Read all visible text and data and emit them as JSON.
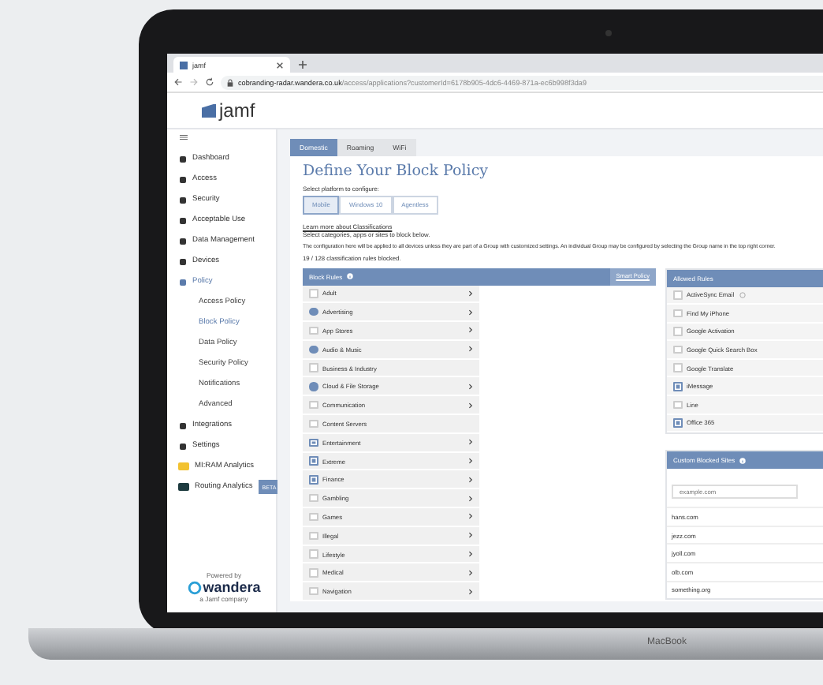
{
  "browser": {
    "tab_title": "jamf",
    "url_host": "cobranding-radar.wandera.co.uk",
    "url_path": "/access/applications?customerId=6178b905-4dc6-4469-871a-ec6b998f3da9"
  },
  "brand": "jamf",
  "sidebar": {
    "items": [
      {
        "label": "Dashboard",
        "kind": "nav",
        "selected": false
      },
      {
        "label": "Access",
        "kind": "nav",
        "selected": false
      },
      {
        "label": "Security",
        "kind": "nav",
        "selected": false
      },
      {
        "label": "Acceptable Use",
        "kind": "nav",
        "selected": false
      },
      {
        "label": "Data Management",
        "kind": "nav",
        "selected": false
      },
      {
        "label": "Devices",
        "kind": "nav",
        "selected": false
      },
      {
        "label": "Policy",
        "kind": "nav",
        "selected": true
      },
      {
        "label": "Access Policy",
        "kind": "sub",
        "selected": false
      },
      {
        "label": "Block Policy",
        "kind": "sub",
        "selected": true
      },
      {
        "label": "Data Policy",
        "kind": "sub",
        "selected": false
      },
      {
        "label": "Security Policy",
        "kind": "sub",
        "selected": false
      },
      {
        "label": "Notifications",
        "kind": "sub",
        "selected": false
      },
      {
        "label": "Advanced",
        "kind": "sub",
        "selected": false
      },
      {
        "label": "Integrations",
        "kind": "nav",
        "selected": false
      },
      {
        "label": "Settings",
        "kind": "nav",
        "selected": false
      },
      {
        "label": "MI:RAM Analytics",
        "kind": "app",
        "selected": false,
        "color": "#f2c230"
      },
      {
        "label": "Routing Analytics",
        "kind": "app",
        "selected": false,
        "color": "#1d3b3f",
        "badge": "BETA"
      }
    ],
    "footer": {
      "powered": "Powered by",
      "logo": "wandera",
      "sub": "a Jamf company"
    }
  },
  "tabs": [
    {
      "label": "Domestic",
      "selected": true
    },
    {
      "label": "Roaming",
      "selected": false
    },
    {
      "label": "WiFi",
      "selected": false
    }
  ],
  "title": "Define Your Block Policy",
  "platform_label": "Select platform to configure:",
  "platforms": [
    {
      "label": "Mobile",
      "selected": true
    },
    {
      "label": "Windows 10",
      "selected": false
    },
    {
      "label": "Agentless",
      "selected": false
    }
  ],
  "learn_link": "Learn more about Classifications",
  "instruction": "Select categories, apps or sites to block below.",
  "note": "The configuration here will be applied to all devices unless they are part of a Group with customized settings. An individual Group may be configured by selecting the Group name in the top right corner.",
  "blocked_count": "19 / 128 classification rules blocked.",
  "block_rules": {
    "title": "Block Rules",
    "link": "Smart Policy",
    "rows": [
      {
        "label": "Adult",
        "checked": false,
        "partial": false,
        "arrow": true
      },
      {
        "label": "Advertising",
        "checked": false,
        "partial": true,
        "arrow": true
      },
      {
        "label": "App Stores",
        "checked": false,
        "partial": false,
        "arrow": true
      },
      {
        "label": "Audio & Music",
        "checked": false,
        "partial": true,
        "arrow": true
      },
      {
        "label": "Business & Industry",
        "checked": false,
        "partial": false,
        "arrow": false
      },
      {
        "label": "Cloud & File Storage",
        "checked": false,
        "partial": true,
        "arrow": true
      },
      {
        "label": "Communication",
        "checked": false,
        "partial": false,
        "arrow": true
      },
      {
        "label": "Content Servers",
        "checked": false,
        "partial": false,
        "arrow": false
      },
      {
        "label": "Entertainment",
        "checked": true,
        "partial": false,
        "arrow": true
      },
      {
        "label": "Extreme",
        "checked": true,
        "partial": false,
        "arrow": true
      },
      {
        "label": "Finance",
        "checked": true,
        "partial": false,
        "arrow": true
      },
      {
        "label": "Gambling",
        "checked": false,
        "partial": false,
        "arrow": true
      },
      {
        "label": "Games",
        "checked": false,
        "partial": false,
        "arrow": true
      },
      {
        "label": "Illegal",
        "checked": false,
        "partial": false,
        "arrow": true
      },
      {
        "label": "Lifestyle",
        "checked": false,
        "partial": false,
        "arrow": true
      },
      {
        "label": "Medical",
        "checked": false,
        "partial": false,
        "arrow": true
      },
      {
        "label": "Navigation",
        "checked": false,
        "partial": false,
        "arrow": true
      }
    ]
  },
  "allowed_rules": {
    "title": "Allowed Rules",
    "rows": [
      {
        "label": "ActiveSync Email",
        "checked": false,
        "info": true
      },
      {
        "label": "Find My iPhone",
        "checked": false,
        "info": false
      },
      {
        "label": "Google Activation",
        "checked": false,
        "info": false
      },
      {
        "label": "Google Quick Search Box",
        "checked": false,
        "info": false
      },
      {
        "label": "Google Translate",
        "checked": false,
        "info": false
      },
      {
        "label": "iMessage",
        "checked": true,
        "info": false
      },
      {
        "label": "Line",
        "checked": false,
        "info": false
      },
      {
        "label": "Office 365",
        "checked": true,
        "info": false
      }
    ]
  },
  "custom_sites": {
    "title": "Custom Blocked Sites",
    "placeholder": "example.com",
    "sites": [
      "hans.com",
      "jezz.com",
      "jyoll.com",
      "olb.com",
      "something.org"
    ]
  },
  "laptop_label": "MacBook"
}
